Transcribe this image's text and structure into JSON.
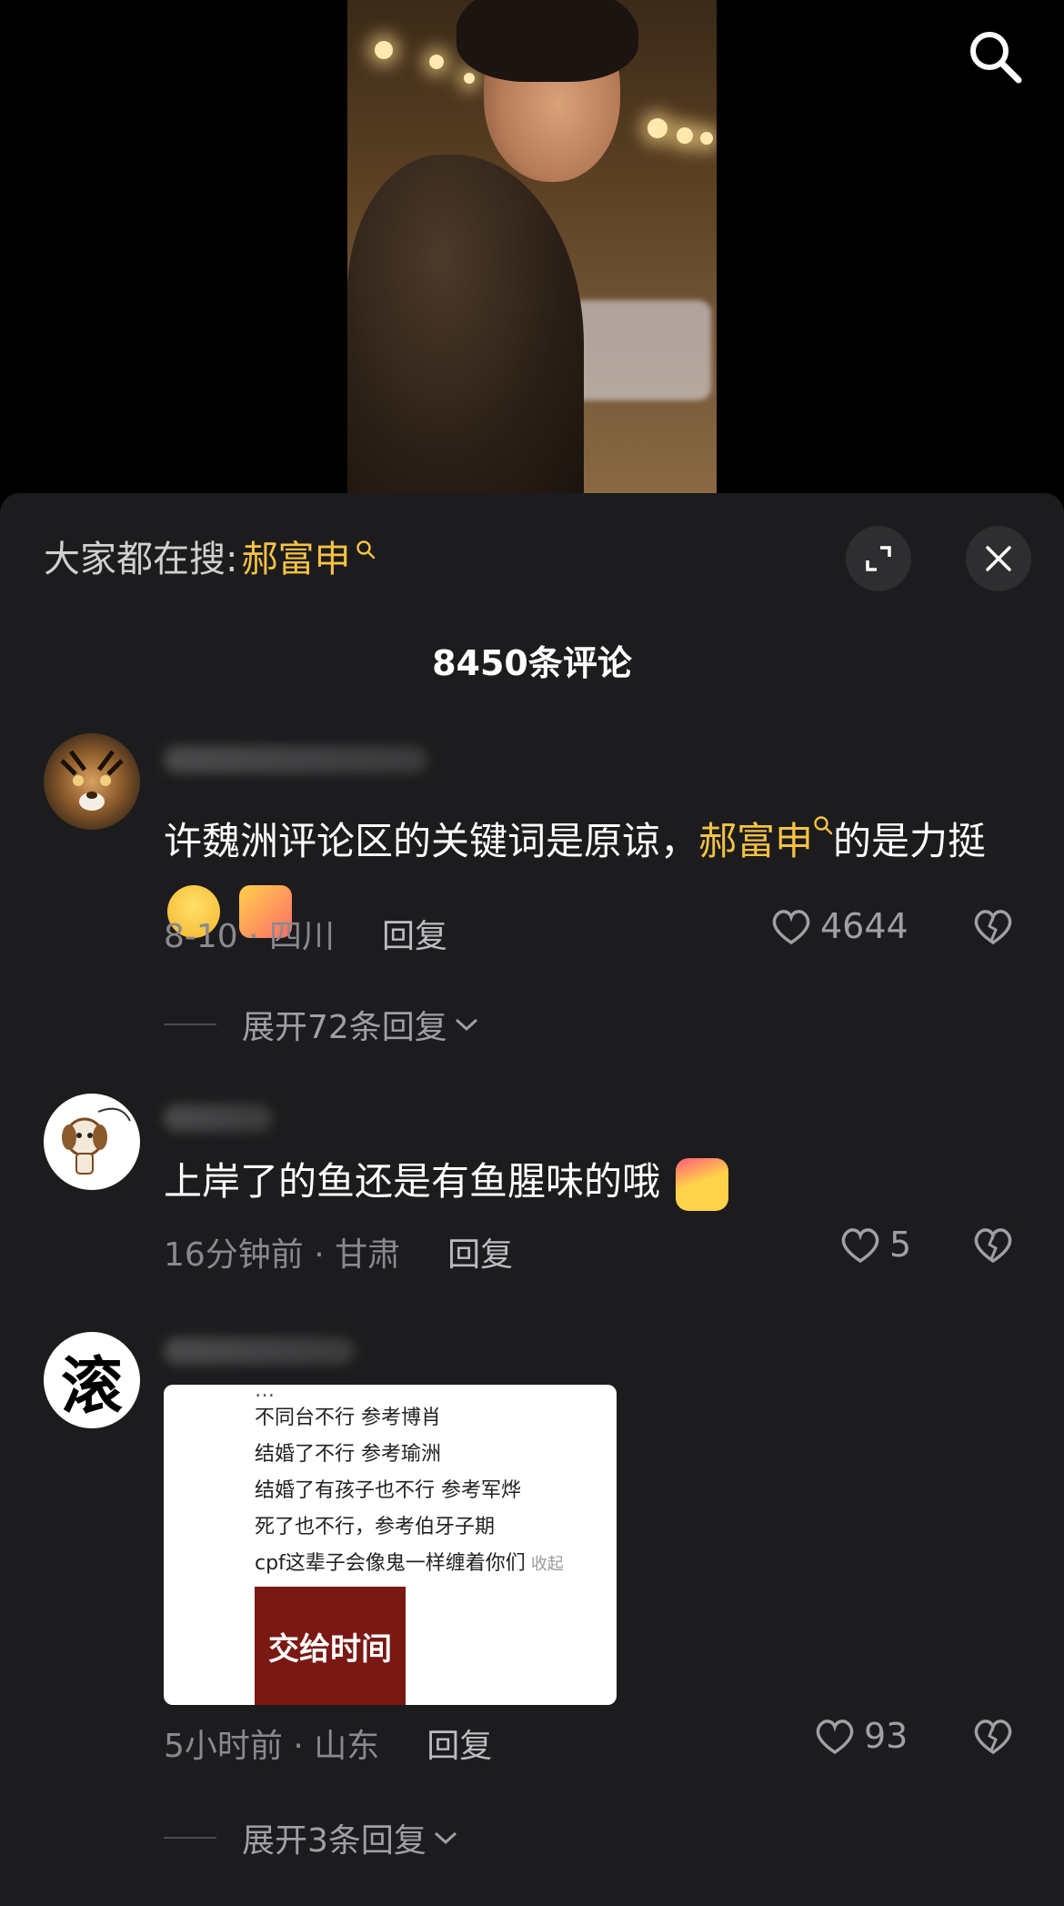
{
  "hot_search": {
    "prefix": "大家都在搜:",
    "term": "郝富申"
  },
  "comment_count": "8450条评论",
  "comments": [
    {
      "text_before": "许魏洲评论区的关键词是原谅，",
      "highlight": "郝富申",
      "text_after": "的是力挺",
      "date": "8-10 · 四川",
      "reply_label": "回复",
      "likes": "4644",
      "expand_label": "展开72条回复"
    },
    {
      "text": "上岸了的鱼还是有鱼腥味的哦",
      "date": "16分钟前 · 甘肃",
      "reply_label": "回复",
      "likes": "5"
    },
    {
      "avatar_char": "滚",
      "image_lines": [
        "不同台不行 参考博肖",
        "结婚了不行 参考瑜洲",
        "结婚了有孩子也不行 参考军烨",
        "死了也不行，参考伯牙子期",
        "cpf这辈子会像鬼一样缠着你们"
      ],
      "image_collapse": "收起",
      "image_block_text": "交给时间",
      "date": "5小时前 · 山东",
      "reply_label": "回复",
      "likes": "93",
      "expand_label": "展开3条回复"
    }
  ],
  "icons": {
    "search": "search-icon",
    "expand": "expand-icon",
    "close": "close-icon",
    "like": "heart-icon",
    "dislike": "broken-heart-icon",
    "chevron": "chevron-down-icon"
  },
  "colors": {
    "accent": "#f5c243",
    "sheet_bg": "#1c1c1e",
    "muted": "#8a8a8e"
  }
}
